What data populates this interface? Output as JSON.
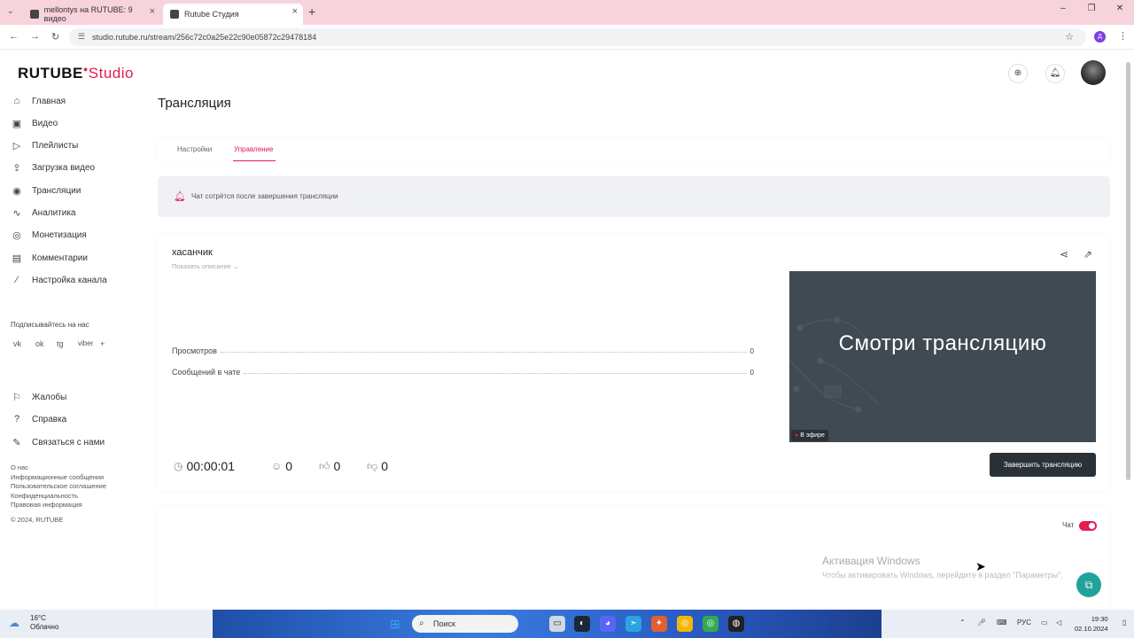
{
  "browser": {
    "tab1_title": "mellontys на RUTUBE: 9 видео",
    "tab2_title": "Rutube Студия",
    "url": "studio.rutube.ru/stream/256c72c0a25e22c90e05872c29478184",
    "profile_letter": "Д"
  },
  "header": {
    "logo_main": "RUTUBE",
    "logo_studio": "Studio"
  },
  "sidebar": {
    "items": [
      {
        "label": "Главная",
        "icon": "home-icon"
      },
      {
        "label": "Видео",
        "icon": "video-icon"
      },
      {
        "label": "Плейлисты",
        "icon": "playlist-icon"
      },
      {
        "label": "Загрузка видео",
        "icon": "upload-icon"
      },
      {
        "label": "Трансляции",
        "icon": "broadcast-icon"
      },
      {
        "label": "Аналитика",
        "icon": "analytics-icon"
      },
      {
        "label": "Монетизация",
        "icon": "monetization-icon"
      },
      {
        "label": "Комментарии",
        "icon": "comments-icon"
      },
      {
        "label": "Настройка канала",
        "icon": "settings-wand-icon"
      }
    ],
    "follow_title": "Подписывайтесь на нас",
    "social": [
      "vk",
      "ok",
      "tg",
      "viber",
      "+"
    ],
    "bottom_items": [
      {
        "label": "Жалобы",
        "icon": "flag-icon"
      },
      {
        "label": "Справка",
        "icon": "help-icon"
      },
      {
        "label": "Связаться с нами",
        "icon": "pencil-icon"
      }
    ],
    "footer_links": [
      "О нас",
      "Информационные сообщения",
      "Пользовательское соглашение",
      "Конфиденциальность",
      "Правовая информация"
    ],
    "copyright": "© 2024, RUTUBE"
  },
  "main": {
    "page_title": "Трансляция",
    "tabs": [
      {
        "label": "Настройки",
        "active": false
      },
      {
        "label": "Управление",
        "active": true
      }
    ],
    "notice": "Чат сотрётся после завершения трансляции",
    "stream": {
      "name": "хасанчик",
      "show_description": "Показать описание",
      "stats": [
        {
          "label": "Просмотров",
          "value": "0"
        },
        {
          "label": "Сообщений в чате",
          "value": "0"
        }
      ],
      "timer": "00:00:01",
      "viewers": "0",
      "likes": "0",
      "dislikes": "0",
      "preview_text": "Смотри трансляцию",
      "live_badge": "В эфире",
      "end_button": "Завершить трансляцию"
    },
    "chat": {
      "label": "Чат",
      "enabled": true
    }
  },
  "overlay": {
    "windows_activation_title": "Активация Windows",
    "windows_activation_text": "Чтобы активировать Windows, перейдите в раздел \"Параметры\"."
  },
  "taskbar": {
    "weather_temp": "16°C",
    "weather_desc": "Облачно",
    "search_placeholder": "Поиск",
    "lang": "РУС",
    "time": "19:30",
    "date": "02.10.2024"
  },
  "colors": {
    "accent": "#e31d4f",
    "dark_button": "#2a3238",
    "preview_bg": "#3f4a52",
    "support": "#1fa39a"
  }
}
